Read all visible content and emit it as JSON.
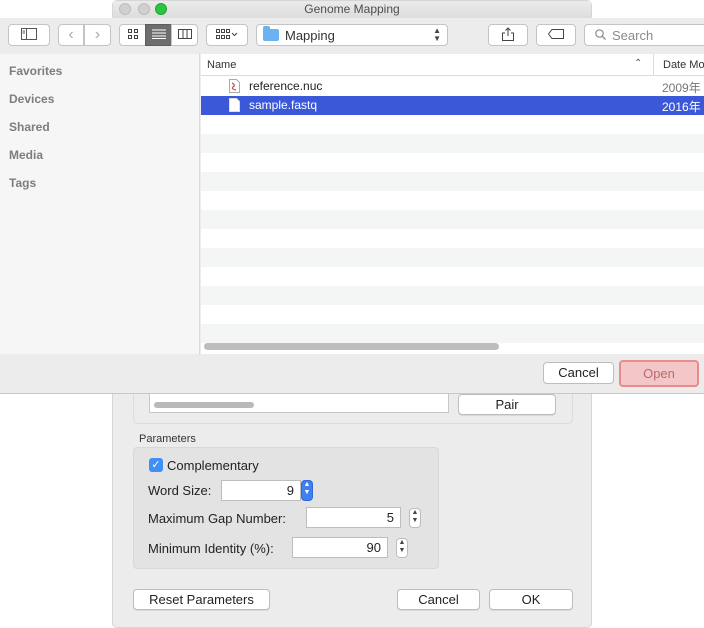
{
  "background_dialog": {
    "title": "Genome Mapping",
    "pair_button": "Pair",
    "parameters": {
      "group_label": "Parameters",
      "complementary": {
        "label": "Complementary",
        "checked": true
      },
      "word_size": {
        "label": "Word Size:",
        "value": "9"
      },
      "max_gap": {
        "label": "Maximum Gap Number:",
        "value": "5"
      },
      "min_identity": {
        "label": "Minimum Identity (%):",
        "value": "90"
      }
    },
    "buttons": {
      "reset": "Reset Parameters",
      "cancel": "Cancel",
      "ok": "OK"
    }
  },
  "open_sheet": {
    "location": "Mapping",
    "search_placeholder": "Search",
    "sidebar": [
      "Favorites",
      "Devices",
      "Shared",
      "Media",
      "Tags"
    ],
    "columns": {
      "name": "Name",
      "date": "Date Mo"
    },
    "files": [
      {
        "name": "reference.nuc",
        "date": "2009年",
        "selected": false,
        "icon": "nuc-file-icon"
      },
      {
        "name": "sample.fastq",
        "date": "2016年",
        "selected": true,
        "icon": "generic-file-icon"
      }
    ],
    "buttons": {
      "cancel": "Cancel",
      "open": "Open"
    },
    "colors": {
      "selection": "#3b58d9",
      "open_button_highlight": "#e98b8b"
    }
  }
}
